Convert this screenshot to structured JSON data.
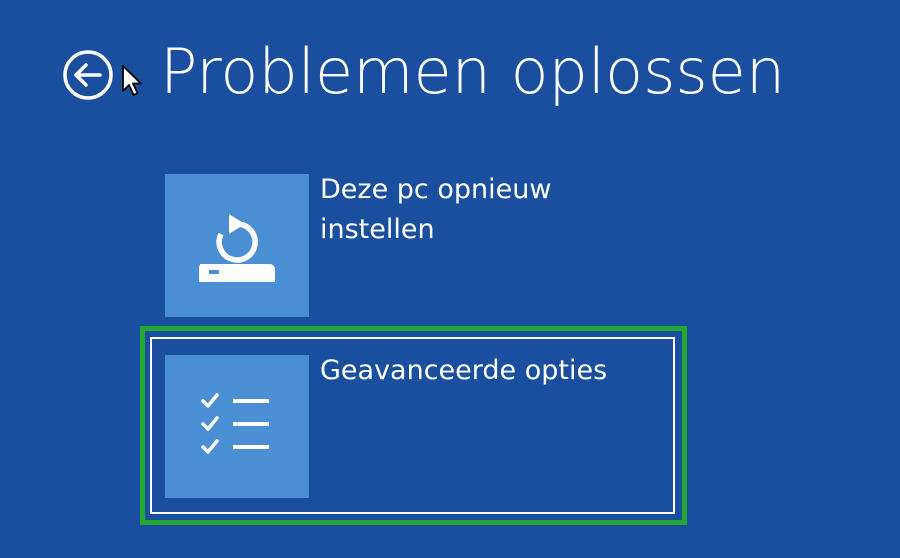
{
  "header": {
    "title": "Problemen oplossen",
    "back_icon": "back-arrow-icon"
  },
  "options": [
    {
      "label": "Deze pc opnieuw instellen",
      "icon": "reset-pc-icon"
    },
    {
      "label": "Geavanceerde opties",
      "icon": "checklist-icon"
    }
  ],
  "colors": {
    "background": "#1a4f9f",
    "tile": "#4a8fd4",
    "highlight": "#22a82e",
    "text": "#ffffff"
  }
}
